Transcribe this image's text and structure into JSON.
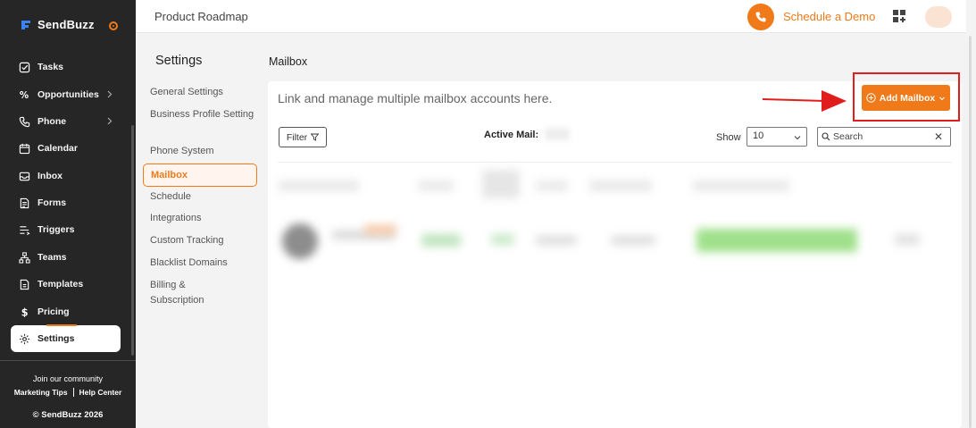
{
  "brand": {
    "name": "SendBuzz"
  },
  "sidebar": {
    "items": [
      {
        "label": "Tasks",
        "icon": "checkbox-icon",
        "has_arrow": false
      },
      {
        "label": "Opportunities",
        "icon": "percent-icon",
        "has_arrow": true
      },
      {
        "label": "Phone",
        "icon": "phone-icon",
        "has_arrow": true
      },
      {
        "label": "Calendar",
        "icon": "calendar-icon",
        "has_arrow": false
      },
      {
        "label": "Inbox",
        "icon": "inbox-icon",
        "has_arrow": false
      },
      {
        "label": "Forms",
        "icon": "form-icon",
        "has_arrow": false
      },
      {
        "label": "Triggers",
        "icon": "trigger-icon",
        "has_arrow": false
      },
      {
        "label": "Teams",
        "icon": "teams-icon",
        "has_arrow": false
      },
      {
        "label": "Templates",
        "icon": "template-icon",
        "has_arrow": false
      },
      {
        "label": "Pricing",
        "icon": "dollar-icon",
        "has_arrow": false
      },
      {
        "label": "Settings",
        "icon": "gear-icon",
        "has_arrow": false,
        "active": true
      }
    ],
    "community_heading": "Join our community",
    "link_marketing_tips": "Marketing Tips",
    "link_help_center": "Help Center",
    "copyright": "© SendBuzz 2026"
  },
  "topbar": {
    "title": "Product Roadmap",
    "demo_label": "Schedule a Demo"
  },
  "settings_menu": {
    "title": "Settings",
    "items": [
      "General Settings",
      "Business Profile Setting",
      "Phone System",
      "Mailbox",
      "Schedule",
      "Integrations",
      "Custom Tracking",
      "Blacklist Domains",
      "Billing & Subscription"
    ],
    "active_index": 3
  },
  "main": {
    "title": "Mailbox",
    "description": "Link and manage multiple mailbox accounts here.",
    "add_button": "Add Mailbox",
    "filter_label": "Filter",
    "active_mail_label": "Active Mail: ",
    "show_label": "Show",
    "show_value": "10",
    "search_placeholder": "Search"
  },
  "colors": {
    "accent": "#f07a1a",
    "sidebar_bg": "#262626",
    "highlight": "#e01e1e"
  }
}
